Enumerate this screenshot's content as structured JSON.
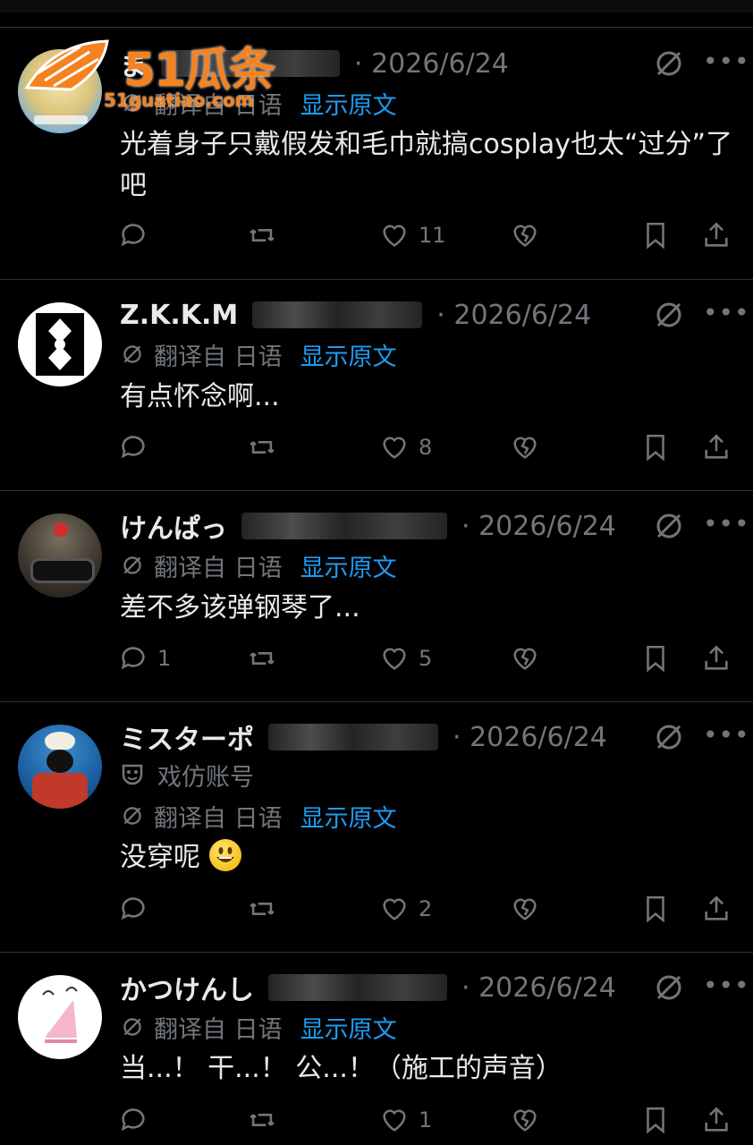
{
  "watermark": {
    "brand": "51瓜条",
    "url": "51guatiao.com"
  },
  "translate": {
    "label": "翻译自 日语",
    "show_original": "显示原文"
  },
  "posts": [
    {
      "name": "ま",
      "handle": "· 2026/6/24",
      "text": "光着身子只戴假发和毛巾就搞cosplay也太“过分”了吧",
      "replies": "",
      "retweets": "",
      "likes": "11"
    },
    {
      "name": "Z.K.K.M",
      "handle": "· 2026/6/24",
      "text": "有点怀念啊...",
      "replies": "",
      "retweets": "",
      "likes": "8"
    },
    {
      "name": "けんぱっ",
      "handle": "· 2026/6/24",
      "text": "差不多该弹钢琴了...",
      "replies": "1",
      "retweets": "",
      "likes": "5"
    },
    {
      "name": "ミスターポ",
      "handle": "· 2026/6/24",
      "parody_label": "戏仿账号",
      "text": "没穿呢",
      "replies": "",
      "retweets": "",
      "likes": "2"
    },
    {
      "name": "かつけんし",
      "handle": "· 2026/6/24",
      "text": "当...！ 干...！ 公...！（施工的声音）",
      "replies": "",
      "retweets": "",
      "likes": "1"
    }
  ]
}
